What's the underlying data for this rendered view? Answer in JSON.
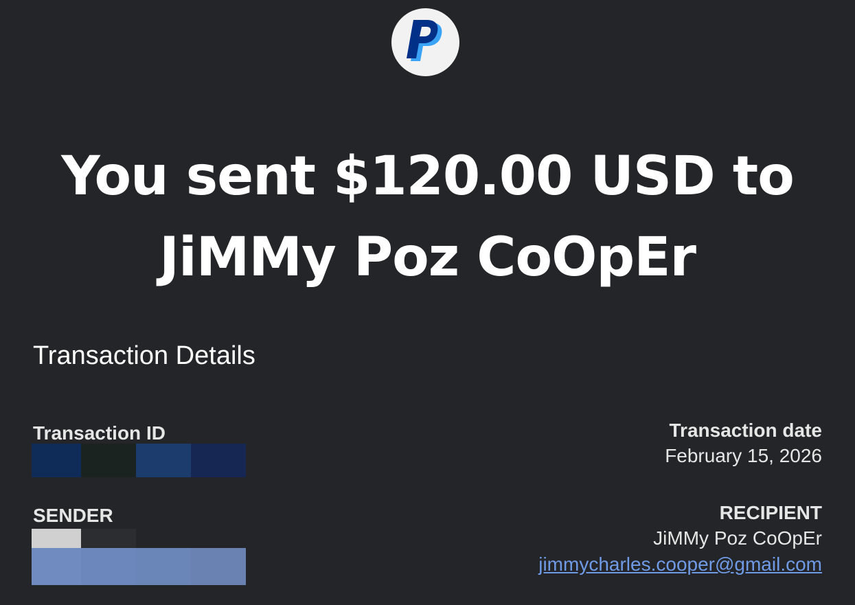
{
  "logo": {
    "icon": "paypal-logo-icon",
    "colors": {
      "dark": "#003087",
      "light": "#3aa3f5"
    }
  },
  "headline": {
    "line1": "You sent $120.00 USD to",
    "line2": "JiMMy Poz CoOpEr"
  },
  "details": {
    "title": "Transaction Details",
    "transaction_id_label": "Transaction ID",
    "transaction_date_label": "Transaction date",
    "transaction_date": "February 15, 2026",
    "sender_label": "SENDER",
    "recipient_label": "RECIPIENT",
    "recipient_name": "JiMMy Poz CoOpEr",
    "recipient_email": "jimmycharles.cooper@gmail.com"
  },
  "colors": {
    "background": "#242528",
    "link": "#6f9be6"
  }
}
